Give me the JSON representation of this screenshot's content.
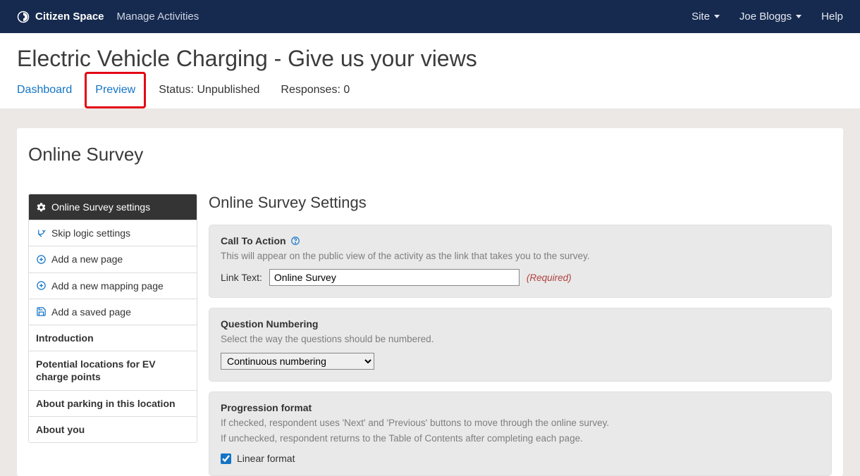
{
  "navbar": {
    "brand": "Citizen Space",
    "primary_link": "Manage Activities",
    "site_menu": "Site",
    "user_menu": "Joe Bloggs",
    "help_link": "Help"
  },
  "page": {
    "title": "Electric Vehicle Charging - Give us your views",
    "tabs": {
      "dashboard": "Dashboard",
      "preview": "Preview",
      "status": "Status: Unpublished",
      "responses": "Responses: 0"
    }
  },
  "panel": {
    "title": "Online Survey"
  },
  "sidebar": {
    "settings_header": "Online Survey settings",
    "skip_logic": "Skip logic settings",
    "add_page": "Add a new page",
    "add_mapping": "Add a new mapping page",
    "add_saved": "Add a saved page",
    "pages": {
      "intro": "Introduction",
      "locations": "Potential locations for EV charge points",
      "parking": "About parking in this location",
      "about_you": "About you"
    }
  },
  "main": {
    "heading": "Online Survey Settings",
    "cta": {
      "title": "Call To Action",
      "desc": "This will appear on the public view of the activity as the link that takes you to the survey.",
      "link_text_label": "Link Text:",
      "link_text_value": "Online Survey",
      "required": "(Required)"
    },
    "numbering": {
      "title": "Question Numbering",
      "desc": "Select the way the questions should be numbered.",
      "selected": "Continuous numbering"
    },
    "progression": {
      "title": "Progression format",
      "desc1": "If checked, respondent uses 'Next' and 'Previous' buttons to move through the online survey.",
      "desc2": "If unchecked, respondent returns to the Table of Contents after completing each page.",
      "checkbox_label": "Linear format"
    }
  }
}
